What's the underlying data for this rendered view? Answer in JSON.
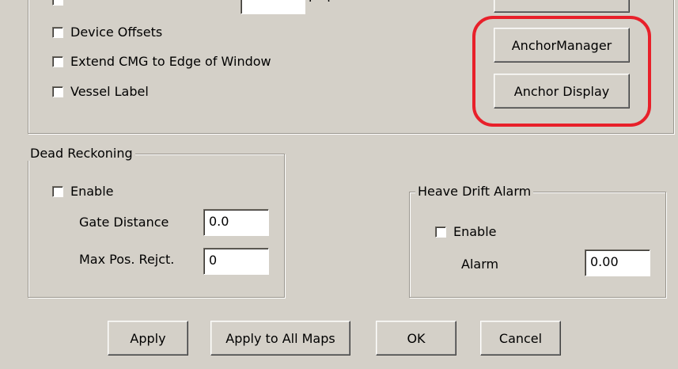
{
  "top_partial": {
    "unit_suffix": "(...)"
  },
  "display_options": {
    "device_offsets": "Device Offsets",
    "extend_cmg": "Extend CMG to Edge of Window",
    "vessel_label": "Vessel Label"
  },
  "anchor": {
    "manager_button": "AnchorManager",
    "display_button": "Anchor Display",
    "highlight_color": "#e8202a"
  },
  "dead_reckoning": {
    "title": "Dead Reckoning",
    "enable_label": "Enable",
    "gate_distance_label": "Gate Distance",
    "gate_distance_value": "0.0",
    "max_pos_label": "Max Pos. Rejct.",
    "max_pos_value": "0"
  },
  "heave_drift": {
    "title": "Heave Drift Alarm",
    "enable_label": "Enable",
    "alarm_label": "Alarm",
    "alarm_value": "0.00"
  },
  "footer": {
    "apply": "Apply",
    "apply_all": "Apply to All Maps",
    "ok": "OK",
    "cancel": "Cancel"
  },
  "colors": {
    "background": "#d4d0c8"
  }
}
